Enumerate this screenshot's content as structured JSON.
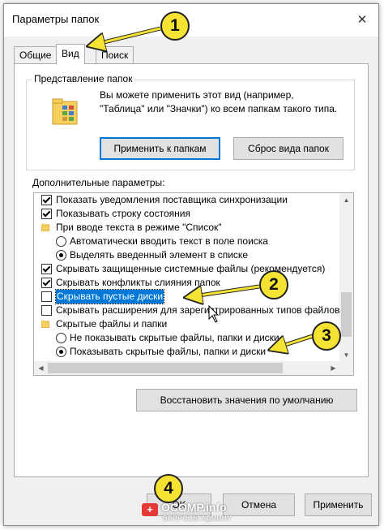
{
  "window": {
    "title": "Параметры папок",
    "close_glyph": "✕"
  },
  "tabs": [
    "Общие",
    "Вид",
    "Поиск"
  ],
  "folder_view": {
    "group_label": "Представление папок",
    "description": "Вы можете применить этот вид (например, \"Таблица\" или \"Значки\") ко всем папкам такого типа.",
    "apply_button": "Применить к папкам",
    "reset_button": "Сброс вида папок"
  },
  "advanced": {
    "label": "Дополнительные параметры:",
    "items": [
      {
        "type": "checkbox",
        "checked": true,
        "text": "Показать уведомления поставщика синхронизации"
      },
      {
        "type": "checkbox",
        "checked": true,
        "text": "Показывать строку состояния"
      },
      {
        "type": "folder",
        "text": "При вводе текста в режиме \"Список\""
      },
      {
        "type": "radio",
        "checked": false,
        "text": "Автоматически вводить текст в поле поиска"
      },
      {
        "type": "radio",
        "checked": true,
        "text": "Выделять введенный элемент в списке"
      },
      {
        "type": "checkbox",
        "checked": true,
        "text": "Скрывать защищенные системные файлы (рекомендуется)"
      },
      {
        "type": "checkbox",
        "checked": true,
        "text": "Скрывать конфликты слияния папок"
      },
      {
        "type": "checkbox",
        "checked": false,
        "selected": true,
        "text": "Скрывать пустые диски"
      },
      {
        "type": "checkbox",
        "checked": false,
        "text": "Скрывать расширения для зарегистрированных типов файлов"
      },
      {
        "type": "folder",
        "text": "Скрытые файлы и папки"
      },
      {
        "type": "radio",
        "checked": false,
        "text": "Не показывать скрытые файлы, папки и диски"
      },
      {
        "type": "radio",
        "checked": true,
        "text": "Показывать скрытые файлы, папки и диски"
      }
    ],
    "restore_button": "Восстановить значения по умолчанию"
  },
  "footer": {
    "ok_button": "OK",
    "cancel_button": "Отмена",
    "apply_button": "Применить"
  },
  "annotations": [
    "1",
    "2",
    "3",
    "4"
  ],
  "watermark": {
    "text": "OCOMP.info",
    "subtext": "ВОПРОСЫ АДМИНУ"
  },
  "colors": {
    "accent": "#0078d7",
    "badge": "#f5e232",
    "dialog_bg": "#f0f0f0"
  }
}
